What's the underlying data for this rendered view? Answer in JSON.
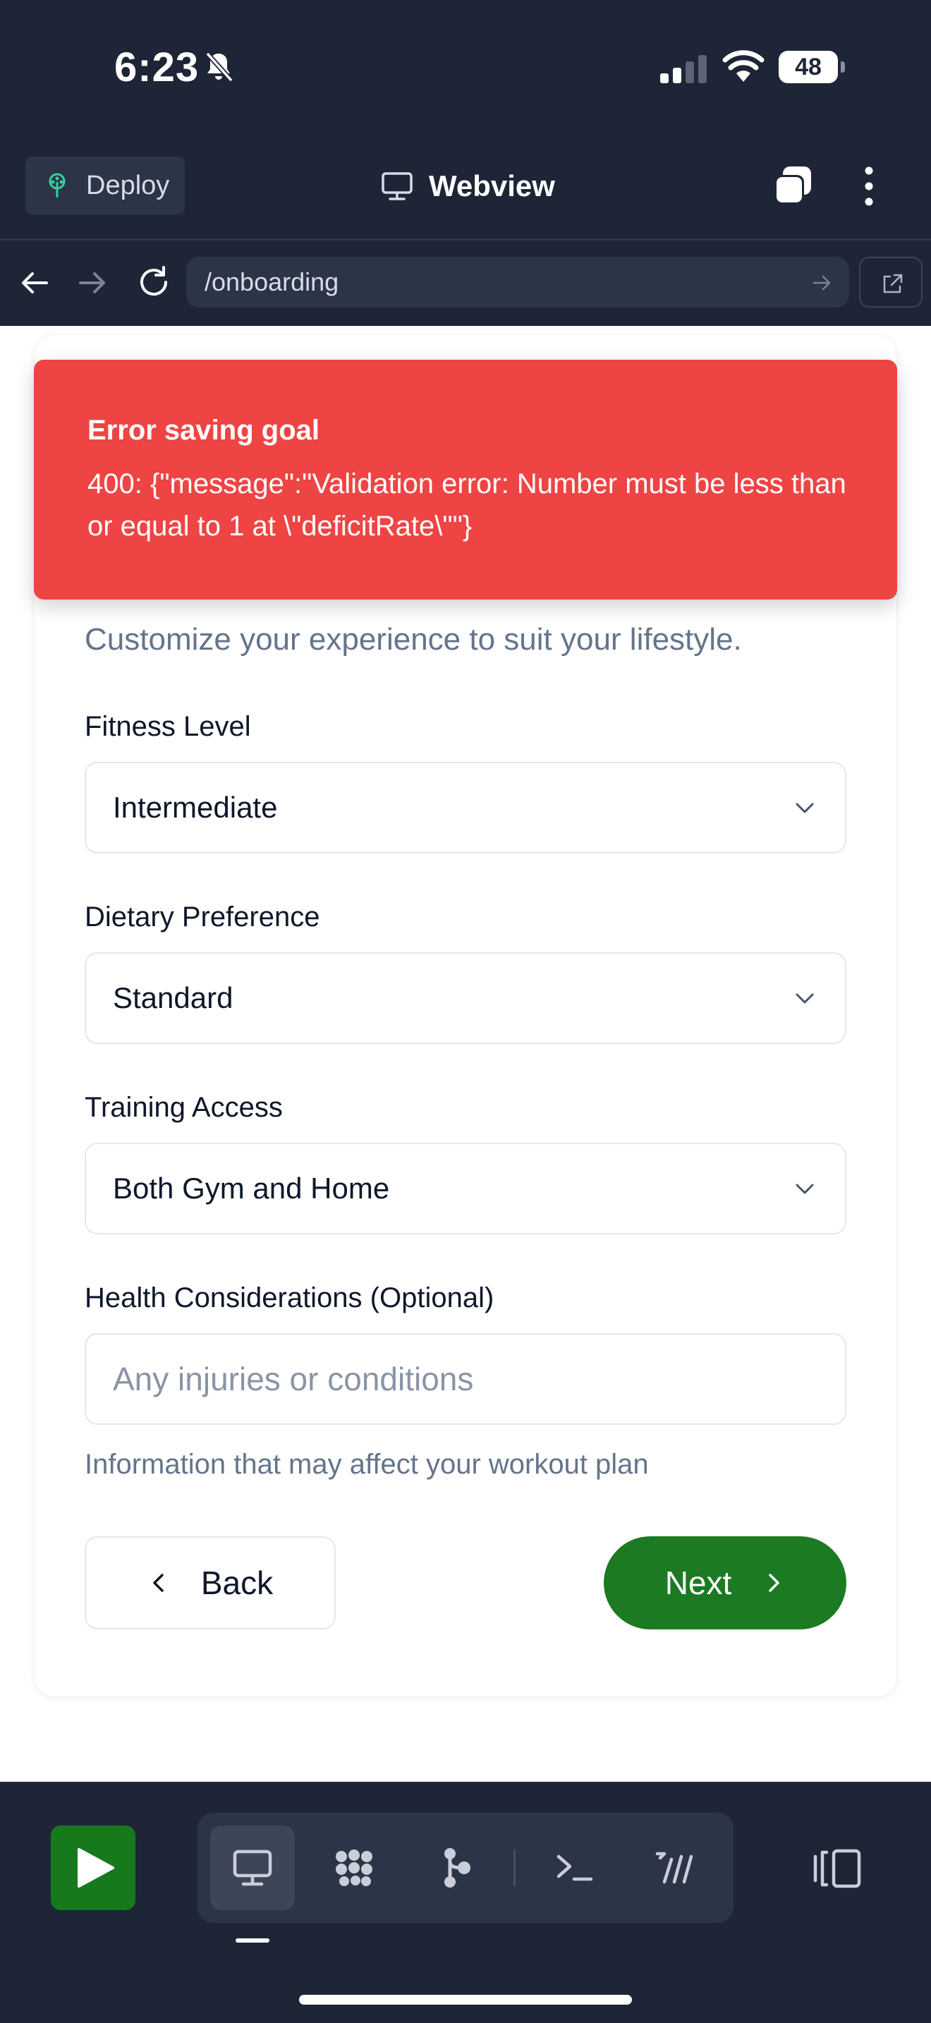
{
  "status_bar": {
    "time": "6:23",
    "battery": "48"
  },
  "header": {
    "deploy_label": "Deploy",
    "title": "Webview"
  },
  "url_bar": {
    "path": "/onboarding"
  },
  "toast": {
    "title": "Error saving goal",
    "message": "400: {\"message\":\"Validation error: Number must be less than or equal to 1 at \\\"deficitRate\\\"\"}"
  },
  "form": {
    "subtitle": "Customize your experience to suit your lifestyle.",
    "fitness_level": {
      "label": "Fitness Level",
      "value": "Intermediate"
    },
    "dietary_preference": {
      "label": "Dietary Preference",
      "value": "Standard"
    },
    "training_access": {
      "label": "Training Access",
      "value": "Both Gym and Home"
    },
    "health": {
      "label": "Health Considerations (Optional)",
      "placeholder": "Any injuries or conditions",
      "help": "Information that may affect your workout plan"
    },
    "back_label": "Back",
    "next_label": "Next"
  },
  "colors": {
    "error": "#ef4444",
    "primary": "#1b7a22",
    "chrome": "#1e2536"
  }
}
